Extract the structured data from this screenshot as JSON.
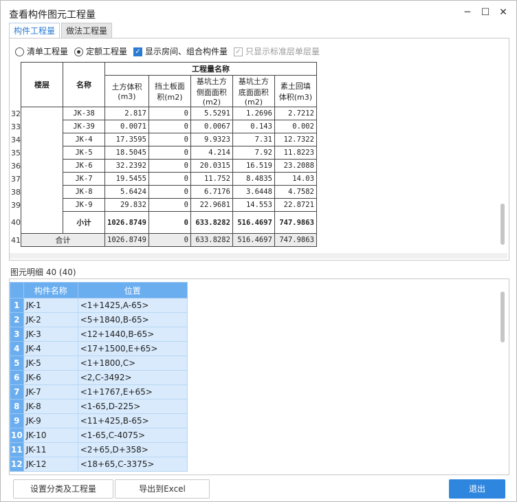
{
  "window": {
    "title": "查看构件图元工程量",
    "minimize": "─",
    "maximize": "☐",
    "close": "✕"
  },
  "tabs": [
    "构件工程量",
    "做法工程量"
  ],
  "options": {
    "radio_list": "清单工程量",
    "radio_quota": "定额工程量",
    "check_rooms": "显示房间、组合构件量",
    "check_standard": "只显示标准层单层量"
  },
  "quantity_table": {
    "header_floor": "楼层",
    "header_name": "名称",
    "header_group": "工程量名称",
    "columns": [
      "土方体积(m3)",
      "挡土板面积(m2)",
      "基坑土方侧面面积(m2)",
      "基坑土方底面面积(m2)",
      "素土回填体积(m3)"
    ],
    "rows": [
      {
        "n": "32",
        "name": "JK-38",
        "v": [
          "2.817",
          "0",
          "5.5291",
          "1.2696",
          "2.7212"
        ]
      },
      {
        "n": "33",
        "name": "JK-39",
        "v": [
          "0.0071",
          "0",
          "0.0067",
          "0.143",
          "0.002"
        ]
      },
      {
        "n": "34",
        "name": "JK-4",
        "v": [
          "17.3595",
          "0",
          "9.9323",
          "7.31",
          "12.7322"
        ]
      },
      {
        "n": "35",
        "name": "JK-5",
        "v": [
          "18.5045",
          "0",
          "4.214",
          "7.92",
          "11.8223"
        ]
      },
      {
        "n": "36",
        "name": "JK-6",
        "v": [
          "32.2392",
          "0",
          "20.0315",
          "16.519",
          "23.2088"
        ]
      },
      {
        "n": "37",
        "name": "JK-7",
        "v": [
          "19.5455",
          "0",
          "11.752",
          "8.4835",
          "14.03"
        ]
      },
      {
        "n": "38",
        "name": "JK-8",
        "v": [
          "5.6424",
          "0",
          "6.7176",
          "3.6448",
          "4.7582"
        ]
      },
      {
        "n": "39",
        "name": "JK-9",
        "v": [
          "29.832",
          "0",
          "22.9681",
          "14.553",
          "22.8721"
        ]
      }
    ],
    "subtotal": {
      "n": "40",
      "label": "小计",
      "v": [
        "1026.8749",
        "0",
        "633.8282",
        "516.4697",
        "747.9863"
      ]
    },
    "total": {
      "n": "41",
      "label": "合计",
      "v": [
        "1026.8749",
        "0",
        "633.8282",
        "516.4697",
        "747.9863"
      ]
    }
  },
  "detail": {
    "label": "图元明细  40 (40)",
    "header_name": "构件名称",
    "header_pos": "位置",
    "rows": [
      {
        "n": "1",
        "name": "JK-1",
        "pos": "<1+1425,A-65>"
      },
      {
        "n": "2",
        "name": "JK-2",
        "pos": "<5+1840,B-65>"
      },
      {
        "n": "3",
        "name": "JK-3",
        "pos": "<12+1440,B-65>"
      },
      {
        "n": "4",
        "name": "JK-4",
        "pos": "<17+1500,E+65>"
      },
      {
        "n": "5",
        "name": "JK-5",
        "pos": "<1+1800,C>"
      },
      {
        "n": "6",
        "name": "JK-6",
        "pos": "<2,C-3492>"
      },
      {
        "n": "7",
        "name": "JK-7",
        "pos": "<1+1767,E+65>"
      },
      {
        "n": "8",
        "name": "JK-8",
        "pos": "<1-65,D-225>"
      },
      {
        "n": "9",
        "name": "JK-9",
        "pos": "<11+425,B-65>"
      },
      {
        "n": "10",
        "name": "JK-10",
        "pos": "<1-65,C-4075>"
      },
      {
        "n": "11",
        "name": "JK-11",
        "pos": "<2+65,D+358>"
      },
      {
        "n": "12",
        "name": "JK-12",
        "pos": "<18+65,C-3375>"
      }
    ]
  },
  "buttons": {
    "classify": "设置分类及工程量",
    "export": "导出到Excel",
    "exit": "退出"
  }
}
